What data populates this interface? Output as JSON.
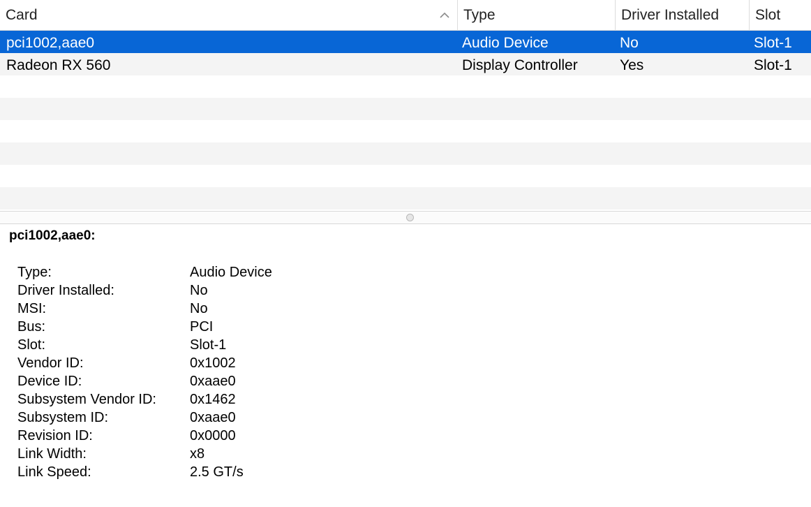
{
  "table": {
    "columns": [
      "Card",
      "Type",
      "Driver Installed",
      "Slot"
    ],
    "sort_icon": "chevron-up-icon",
    "rows": [
      {
        "card": "pci1002,aae0",
        "type": "Audio Device",
        "driver_installed": "No",
        "slot": "Slot-1",
        "selected": true
      },
      {
        "card": "Radeon RX 560",
        "type": "Display Controller",
        "driver_installed": "Yes",
        "slot": "Slot-1",
        "selected": false
      }
    ]
  },
  "detail": {
    "title": "pci1002,aae0:",
    "properties": [
      {
        "key": "Type:",
        "value": "Audio Device"
      },
      {
        "key": "Driver Installed:",
        "value": "No"
      },
      {
        "key": "MSI:",
        "value": "No"
      },
      {
        "key": "Bus:",
        "value": "PCI"
      },
      {
        "key": "Slot:",
        "value": "Slot-1"
      },
      {
        "key": "Vendor ID:",
        "value": "0x1002"
      },
      {
        "key": "Device ID:",
        "value": "0xaae0"
      },
      {
        "key": "Subsystem Vendor ID:",
        "value": "0x1462"
      },
      {
        "key": "Subsystem ID:",
        "value": "0xaae0"
      },
      {
        "key": "Revision ID:",
        "value": "0x0000"
      },
      {
        "key": "Link Width:",
        "value": "x8"
      },
      {
        "key": "Link Speed:",
        "value": "2.5 GT/s"
      }
    ]
  },
  "colors": {
    "selection": "#0866d6",
    "stripe": "#f4f4f4"
  }
}
